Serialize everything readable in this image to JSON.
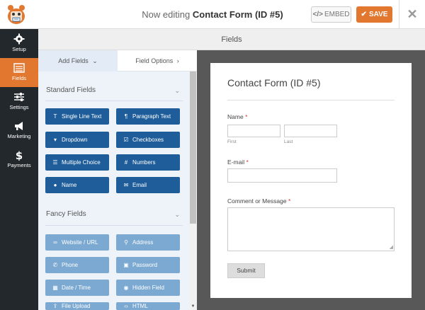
{
  "header": {
    "title_prefix": "Now editing",
    "title_form": "Contact Form (ID #5)",
    "embed_label": "EMBED",
    "embed_icon": "code-icon",
    "save_label": "SAVE",
    "save_icon": "check-icon",
    "close_icon": "close-icon",
    "accent_color": "#e27730"
  },
  "sidebar": {
    "items": [
      {
        "label": "Setup",
        "icon": "gear-icon",
        "active": false
      },
      {
        "label": "Fields",
        "icon": "list-icon",
        "active": true
      },
      {
        "label": "Settings",
        "icon": "sliders-icon",
        "active": false
      },
      {
        "label": "Marketing",
        "icon": "megaphone-icon",
        "active": false
      },
      {
        "label": "Payments",
        "icon": "dollar-icon",
        "active": false
      }
    ]
  },
  "fields_bar": {
    "title": "Fields"
  },
  "panel": {
    "tabs": [
      {
        "label": "Add Fields",
        "icon": "chevron-down-icon",
        "active": true
      },
      {
        "label": "Field Options",
        "icon": "chevron-right-icon",
        "active": false
      }
    ],
    "standard": {
      "title": "Standard Fields",
      "buttons": [
        {
          "label": "Single Line Text",
          "icon": "text-icon",
          "glyph": "T"
        },
        {
          "label": "Paragraph Text",
          "icon": "paragraph-icon",
          "glyph": "¶"
        },
        {
          "label": "Dropdown",
          "icon": "dropdown-icon",
          "glyph": "▾"
        },
        {
          "label": "Checkboxes",
          "icon": "checkbox-icon",
          "glyph": "☑"
        },
        {
          "label": "Multiple Choice",
          "icon": "list-bullets-icon",
          "glyph": "☰"
        },
        {
          "label": "Numbers",
          "icon": "hash-icon",
          "glyph": "#"
        },
        {
          "label": "Name",
          "icon": "user-icon",
          "glyph": "●"
        },
        {
          "label": "Email",
          "icon": "envelope-icon",
          "glyph": "✉"
        }
      ]
    },
    "fancy": {
      "title": "Fancy Fields",
      "buttons": [
        {
          "label": "Website / URL",
          "icon": "link-icon",
          "glyph": "∞"
        },
        {
          "label": "Address",
          "icon": "map-marker-icon",
          "glyph": "⚲"
        },
        {
          "label": "Phone",
          "icon": "phone-icon",
          "glyph": "✆"
        },
        {
          "label": "Password",
          "icon": "lock-icon",
          "glyph": "🔒"
        },
        {
          "label": "Date / Time",
          "icon": "calendar-icon",
          "glyph": "▦"
        },
        {
          "label": "Hidden Field",
          "icon": "eye-slash-icon",
          "glyph": "◉"
        },
        {
          "label": "File Upload",
          "icon": "upload-icon",
          "glyph": "⇪"
        },
        {
          "label": "HTML",
          "icon": "code-icon",
          "glyph": "‹›"
        }
      ]
    }
  },
  "form": {
    "title": "Contact Form (ID #5)",
    "name_label": "Name",
    "first_sublabel": "First",
    "last_sublabel": "Last",
    "email_label": "E-mail",
    "message_label": "Comment or Message",
    "required_mark": "*",
    "submit_label": "Submit"
  }
}
